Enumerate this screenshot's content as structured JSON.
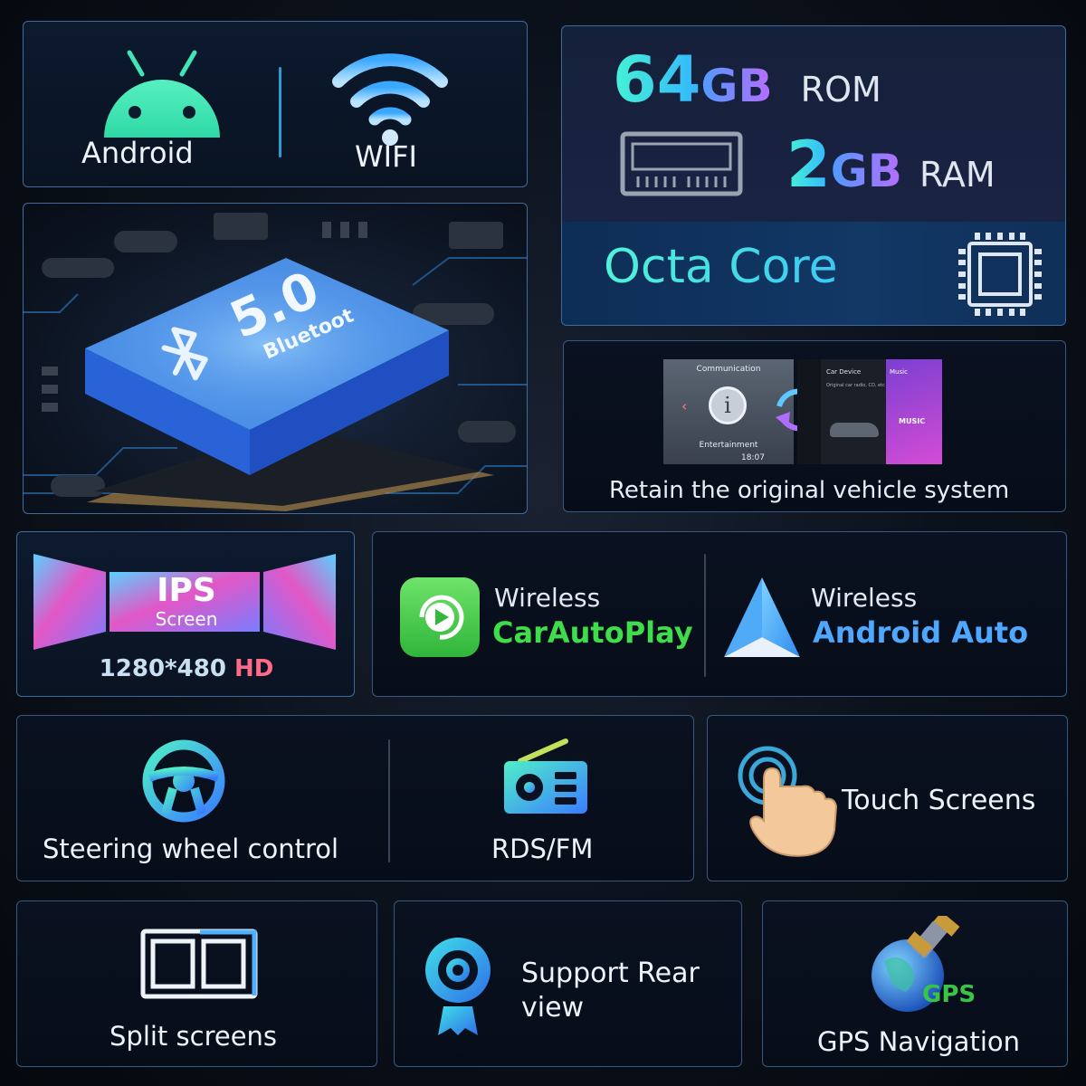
{
  "android": {
    "label": "Android"
  },
  "wifi": {
    "label": "WIFI"
  },
  "memory": {
    "rom_value": "64",
    "rom_unit": "GB",
    "rom_label": "ROM",
    "ram_value": "2",
    "ram_unit": "GB",
    "ram_label": "RAM"
  },
  "cpu": {
    "label": "Octa Core"
  },
  "bluetooth": {
    "version": "5.0",
    "label": "Bluetoot"
  },
  "original_system": {
    "caption": "Retain the original vehicle system",
    "screen_left": {
      "title": "Communication",
      "bottom": "Entertainment",
      "time": "18:07"
    },
    "screen_right": {
      "card1_title": "Car Device",
      "card1_sub": "Original car radio, CD, etc",
      "card2_title": "Music",
      "card2_badge": "MUSIC"
    }
  },
  "display": {
    "badge_big": "IPS",
    "badge_small": "Screen",
    "resolution": "1280*480",
    "hd": "HD"
  },
  "carplay": {
    "top": "Wireless",
    "name": "CarAutoPlay"
  },
  "android_auto": {
    "top": "Wireless",
    "name": "Android Auto"
  },
  "features": {
    "steering": "Steering wheel control",
    "radio": "RDS/FM",
    "touch": "Touch Screens",
    "split": "Split screens",
    "rear_line1": "Support Rear",
    "rear_line2": "view",
    "gps_label": "GPS Navigation",
    "gps_badge": "GPS"
  },
  "colors": {
    "accent_cyan": "#3fe6e0",
    "accent_blue": "#2f9bd3",
    "carplay_green": "#3ac447",
    "aa_blue": "#4fa8ff"
  },
  "icons": [
    "android-icon",
    "wifi-icon",
    "memory-chip-icon",
    "cpu-icon",
    "bluetooth-icon",
    "carplay-icon",
    "android-auto-icon",
    "steering-wheel-icon",
    "radio-icon",
    "touch-icon",
    "split-screen-icon",
    "camera-icon",
    "gps-globe-icon"
  ]
}
